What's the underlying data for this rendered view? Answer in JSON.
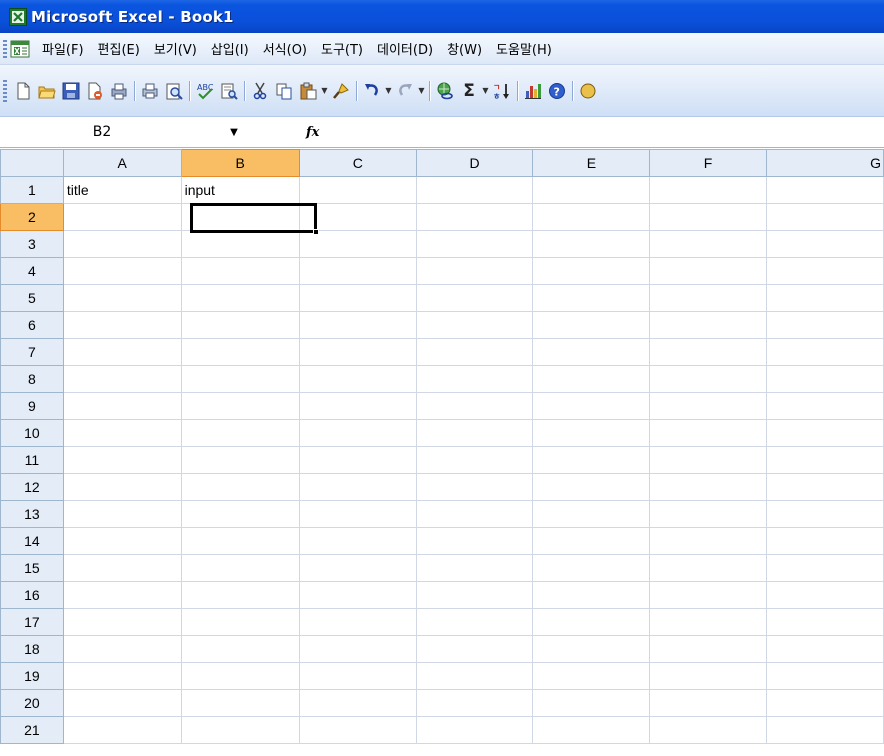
{
  "window": {
    "title": "Microsoft Excel - Book1"
  },
  "menu": {
    "items": [
      "파일(F)",
      "편집(E)",
      "보기(V)",
      "삽입(I)",
      "서식(O)",
      "도구(T)",
      "데이터(D)",
      "창(W)",
      "도움말(H)"
    ]
  },
  "toolbar": {
    "buttons": [
      "new-icon",
      "open-icon",
      "save-icon",
      "permission-icon",
      "print-preview-setup-icon",
      "print-icon",
      "print-preview-icon",
      "spelling-icon",
      "research-icon",
      "cut-icon",
      "copy-icon",
      "paste-icon",
      "format-painter-icon",
      "undo-icon",
      "redo-icon",
      "hyperlink-icon",
      "autosum-icon",
      "sort-ascending-icon",
      "chart-wizard-icon",
      "help-icon"
    ],
    "autosum_glyph": "Σ"
  },
  "formula_bar": {
    "name_box": "B2",
    "fx_label": "fx",
    "formula": ""
  },
  "sheet": {
    "columns": [
      "A",
      "B",
      "C",
      "D",
      "E",
      "F",
      "G"
    ],
    "selected_column": "B",
    "rows": [
      "1",
      "2",
      "3",
      "4",
      "5",
      "6",
      "7",
      "8",
      "9",
      "10",
      "11",
      "12",
      "13",
      "14",
      "15",
      "16",
      "17",
      "18",
      "19",
      "20",
      "21"
    ],
    "selected_row": "2",
    "cells": {
      "A1": "title",
      "B1": "input"
    },
    "active_cell": "B2"
  },
  "colors": {
    "titlebar": "#0a55e0",
    "header_bg": "#e4ecf7",
    "header_selected": "#f9be63",
    "gridline": "#d0d7e5"
  }
}
